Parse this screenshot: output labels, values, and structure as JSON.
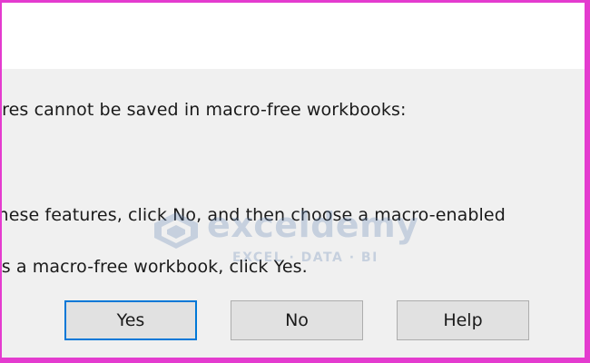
{
  "dialog": {
    "message_line_1": "ures cannot be saved in macro-free workbooks:",
    "message_line_2": "these features, click No, and then choose a macro-enabled",
    "message_line_3": " as a macro-free workbook, click Yes."
  },
  "buttons": {
    "yes_label": "Yes",
    "no_label": "No",
    "help_label": "Help"
  },
  "watermark": {
    "name": "exceldemy",
    "tagline": "EXCEL · DATA · BI"
  },
  "colors": {
    "frame": "#e43bcf",
    "focus_border": "#0078d7",
    "dialog_bg": "#f0f0f0",
    "title_bg": "#ffffff",
    "button_bg": "#e1e1e1",
    "watermark": "#5b7fb0"
  }
}
